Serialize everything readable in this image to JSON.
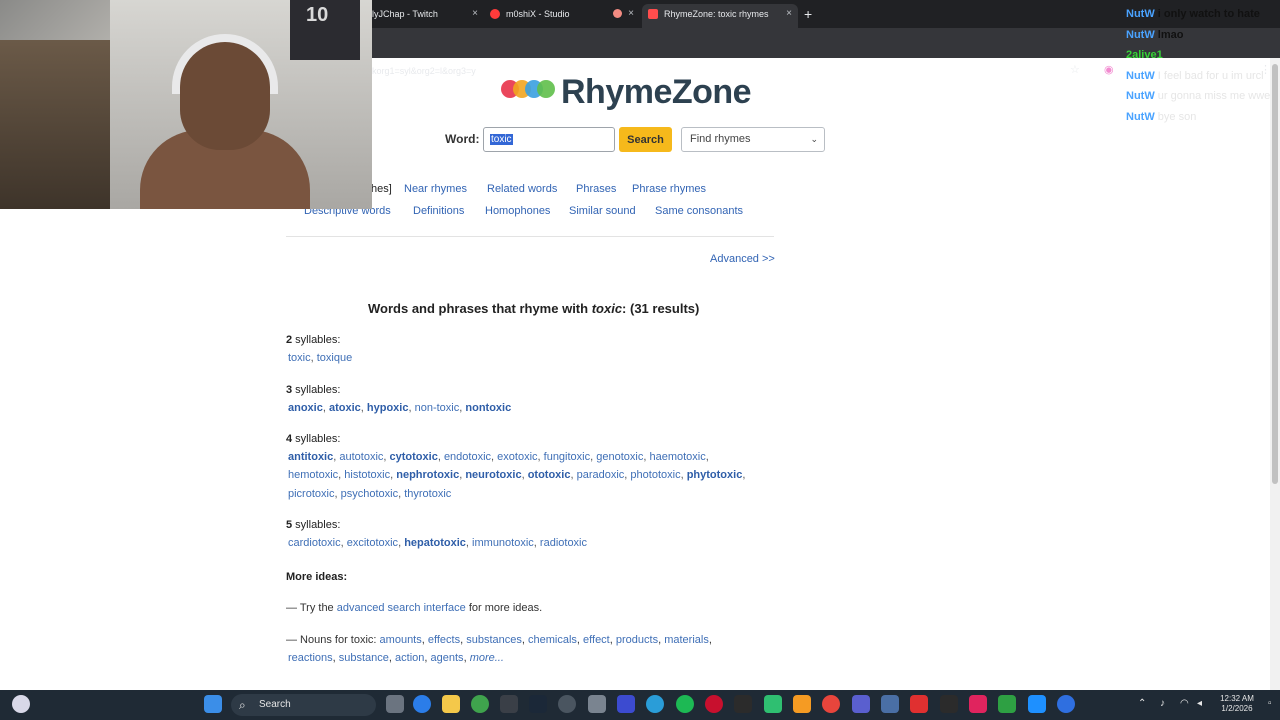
{
  "browser": {
    "tabs": [
      {
        "title": "lyJChap - Twitch",
        "favicon_color": "#9146ff"
      },
      {
        "title": "m0shiX - Studio",
        "favicon_color": "#ff3b3b"
      },
      {
        "title": "RhymeZone: toxic rhymes",
        "favicon_color": "#ff4d4d"
      }
    ],
    "new_tab_label": "+",
    "close_label": "×",
    "url": "korg1=syl&org2=l&org3=y",
    "bookmark_icon": "star-icon"
  },
  "webcam": {
    "jersey_number": "10"
  },
  "rhymezone": {
    "logo_text": "RhymeZone",
    "logo_dot_colors": [
      "#e8334a",
      "#f2a51f",
      "#3aa0e0",
      "#5fbf4a"
    ],
    "word_label": "Word:",
    "search_value": "toxic",
    "search_button": "Search",
    "mode_select": "Find rhymes",
    "nav_row1": [
      "hes]",
      "Near rhymes",
      "Related words",
      "Phrases",
      "Phrase rhymes"
    ],
    "nav_row2": [
      "Descriptive words",
      "Definitions",
      "Homophones",
      "Similar sound",
      "Same consonants"
    ],
    "advanced_link": "Advanced >>",
    "results": {
      "prefix": "Words and phrases that rhyme with ",
      "word": "toxic",
      "suffix": ":  (31 results)"
    },
    "groups": {
      "g2": {
        "label_num": "2",
        "label_rest": " syllables:"
      },
      "g3": {
        "label_num": "3",
        "label_rest": " syllables:"
      },
      "g4": {
        "label_num": "4",
        "label_rest": " syllables:"
      },
      "g5": {
        "label_num": "5",
        "label_rest": " syllables:"
      }
    },
    "words": {
      "toxic": "toxic",
      "toxique": "toxique",
      "anoxic": "anoxic",
      "atoxic": "atoxic",
      "hypoxic": "hypoxic",
      "non_toxic": "non-toxic",
      "nontoxic": "nontoxic",
      "antitoxic": "antitoxic",
      "autotoxic": "autotoxic",
      "cytotoxic": "cytotoxic",
      "endotoxic": "endotoxic",
      "exotoxic": "exotoxic",
      "fungitoxic": "fungitoxic",
      "genotoxic": "genotoxic",
      "haemotoxic": "haemotoxic",
      "hemotoxic": "hemotoxic",
      "histotoxic": "histotoxic",
      "nephrotoxic": "nephrotoxic",
      "neurotoxic": "neurotoxic",
      "ototoxic": "ototoxic",
      "paradoxic": "paradoxic",
      "phototoxic": "phototoxic",
      "phytotoxic": "phytotoxic",
      "picrotoxic": "picrotoxic",
      "psychotoxic": "psychotoxic",
      "thyrotoxic": "thyrotoxic",
      "cardiotoxic": "cardiotoxic",
      "excitotoxic": "excitotoxic",
      "hepatotoxic": "hepatotoxic",
      "immunotoxic": "immunotoxic",
      "radiotoxic": "radiotoxic"
    },
    "more_ideas": {
      "heading": "More ideas:",
      "try_prefix": "— Try the ",
      "try_link": "advanced search interface",
      "try_suffix": " for more ideas.",
      "nouns_prefix": "— Nouns for toxic: ",
      "nouns": [
        "amounts",
        "effects",
        "substances",
        "chemicals",
        "effect",
        "products",
        "materials",
        "reactions",
        "substance",
        "action",
        "agents"
      ],
      "more": "more..."
    }
  },
  "chat": [
    {
      "user": "NutW",
      "msg": "i only watch to hate",
      "faint": false,
      "green": false
    },
    {
      "user": "NutW",
      "msg": "lmao",
      "faint": false,
      "green": false
    },
    {
      "user": "2alive1",
      "msg": "",
      "faint": false,
      "green": true
    },
    {
      "user": "NutW",
      "msg": "I feel bad for u im urcl",
      "faint": true,
      "green": false
    },
    {
      "user": "NutW",
      "msg": "ur gonna miss me wwe",
      "faint": true,
      "green": false
    },
    {
      "user": "NutW",
      "msg": "bye son",
      "faint": true,
      "green": false
    }
  ],
  "taskbar": {
    "search_label": "Search",
    "time": "12:32 AM",
    "date": "1/2/2026"
  }
}
